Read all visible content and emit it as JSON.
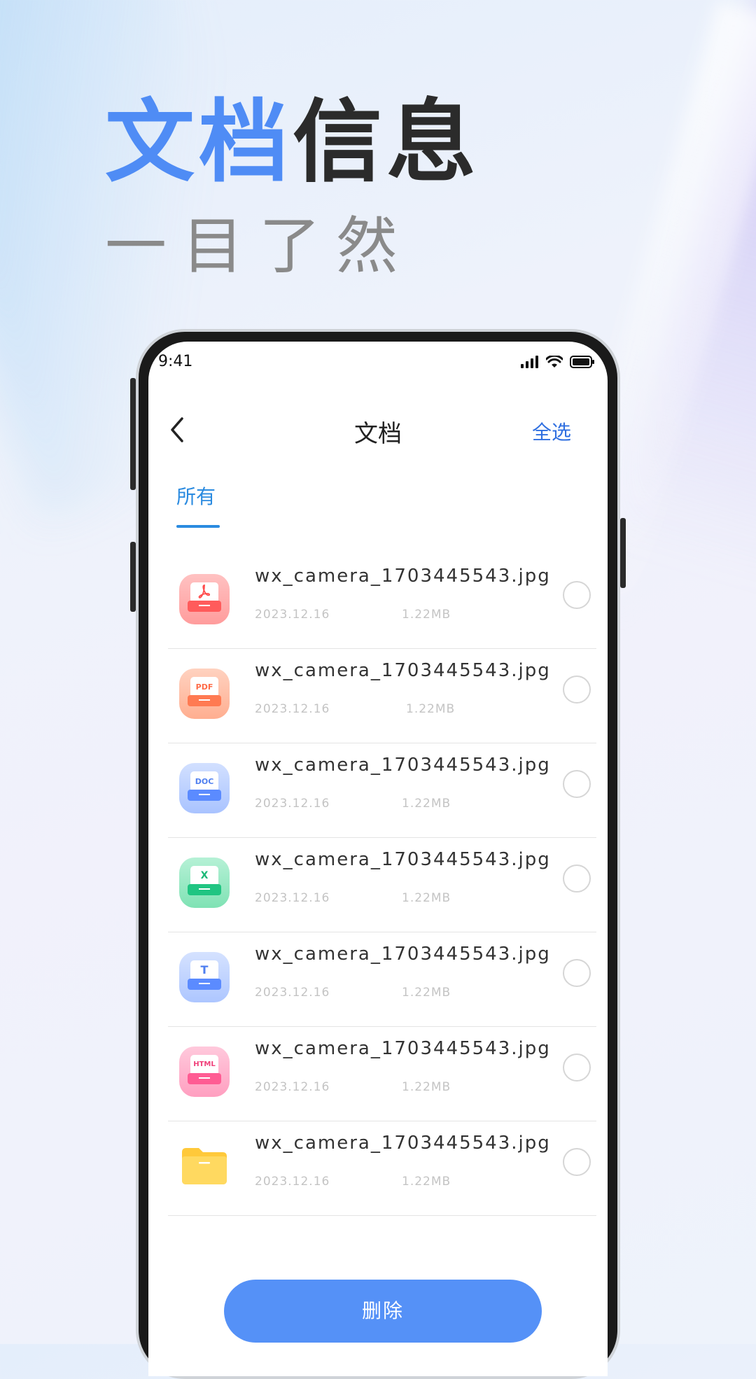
{
  "promo": {
    "headline_blue": "文档",
    "headline_dark": "信息",
    "subheadline": "一目了然"
  },
  "status_bar": {
    "time": "9:41",
    "icons": [
      "signal-icon",
      "wifi-icon",
      "battery-icon"
    ]
  },
  "nav": {
    "back_icon": "chevron-left-icon",
    "title": "文档",
    "select_all": "全选"
  },
  "tabs": [
    {
      "label": "所有",
      "active": true
    }
  ],
  "files": [
    {
      "icon": "pdf-acrobat-icon",
      "name": "wx_camera_1703445543.jpg",
      "date": "2023.12.16",
      "size": "1.22MB",
      "selected": false
    },
    {
      "icon": "pdf-icon",
      "badge": "PDF",
      "name": "wx_camera_1703445543.jpg",
      "date": "2023.12.16",
      "size": "1.22MB",
      "selected": false
    },
    {
      "icon": "doc-icon",
      "badge": "DOC",
      "name": "wx_camera_1703445543.jpg",
      "date": "2023.12.16",
      "size": "1.22MB",
      "selected": false
    },
    {
      "icon": "excel-icon",
      "badge": "X",
      "name": "wx_camera_1703445543.jpg",
      "date": "2023.12.16",
      "size": "1.22MB",
      "selected": false
    },
    {
      "icon": "text-icon",
      "badge": "T",
      "name": "wx_camera_1703445543.jpg",
      "date": "2023.12.16",
      "size": "1.22MB",
      "selected": false
    },
    {
      "icon": "html-icon",
      "badge": "HTML",
      "name": "wx_camera_1703445543.jpg",
      "date": "2023.12.16",
      "size": "1.22MB",
      "selected": false
    },
    {
      "icon": "folder-icon",
      "name": "wx_camera_1703445543.jpg",
      "date": "2023.12.16",
      "size": "1.22MB",
      "selected": false
    }
  ],
  "actions": {
    "delete_label": "删除"
  },
  "colors": {
    "accent_blue": "#4f8cf5",
    "tab_blue": "#2b8be0",
    "delete_button": "#5591f7"
  }
}
